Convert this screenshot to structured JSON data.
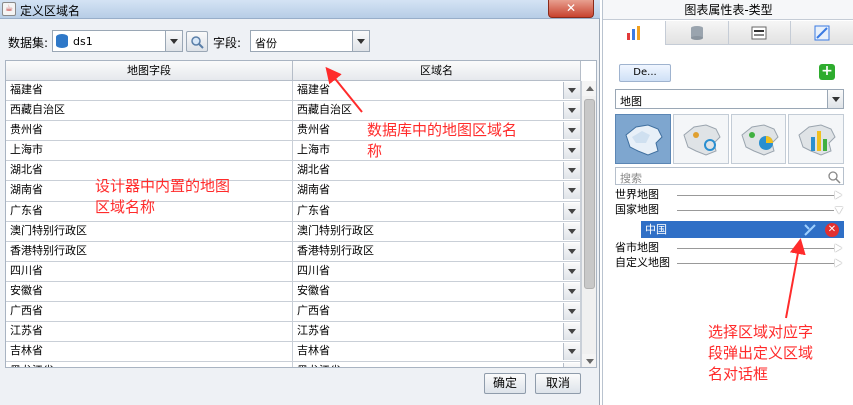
{
  "dialog": {
    "title": "定义区域名",
    "title_icon": "java-cup-icon",
    "close_glyph": "✕",
    "dataset_label": "数据集:",
    "dataset_value": "ds1",
    "field_label": "字段:",
    "field_value": "省份",
    "columns": [
      "地图字段",
      "区域名"
    ],
    "rows": [
      [
        "福建省",
        "福建省"
      ],
      [
        "西藏自治区",
        "西藏自治区"
      ],
      [
        "贵州省",
        "贵州省"
      ],
      [
        "上海市",
        "上海市"
      ],
      [
        "湖北省",
        "湖北省"
      ],
      [
        "湖南省",
        "湖南省"
      ],
      [
        "广东省",
        "广东省"
      ],
      [
        "澳门特别行政区",
        "澳门特别行政区"
      ],
      [
        "香港特别行政区",
        "香港特别行政区"
      ],
      [
        "四川省",
        "四川省"
      ],
      [
        "安徽省",
        "安徽省"
      ],
      [
        "广西省",
        "广西省"
      ],
      [
        "江苏省",
        "江苏省"
      ],
      [
        "吉林省",
        "吉林省"
      ],
      [
        "黑龙江省",
        "黑龙江省"
      ]
    ],
    "ok_label": "确定",
    "cancel_label": "取消"
  },
  "annotations": {
    "db_region_lines": [
      "数据库中的地图区域名",
      "称"
    ],
    "designer_region_lines": [
      "设计器中内置的地图",
      "区域名称"
    ],
    "select_region_lines": [
      "选择区域对应字",
      "段弹出定义区域",
      "名对话框"
    ],
    "color": "#ff2b2b"
  },
  "panel": {
    "title": "图表属性表-类型",
    "tabs": [
      "chart-type-icon",
      "database-icon",
      "style-abc-icon",
      "effects-icon"
    ],
    "de_button_label": "De...",
    "add_icon": "plus-icon",
    "chart_type_value": "地图",
    "thumbnails": [
      "map-china-thumb",
      "map-bubble-thumb",
      "map-pie-thumb",
      "map-bar-thumb"
    ],
    "search_placeholder": "搜索",
    "tree": {
      "world_map": "世界地图",
      "country_map": "国家地图",
      "selected_child": "中国",
      "province_map": "省市地图",
      "custom_map": "自定义地图"
    }
  }
}
